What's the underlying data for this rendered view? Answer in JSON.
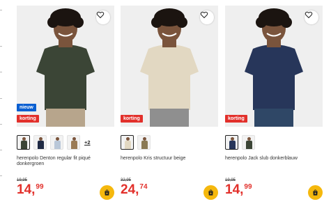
{
  "products": [
    {
      "title": "herenpolo Denton regular fit piqué donkergroen",
      "badges": {
        "new": "nieuw",
        "sale": "korting"
      },
      "old_price": "19,95",
      "price_int": "14,",
      "price_dec": "99",
      "more_colors": "+2",
      "shirt_color": "#3b4536",
      "pants_color": "#b7a58c",
      "swatch_colors": [
        "#3b4536",
        "#1f2a44",
        "#b9c7d8",
        "#9a7b55"
      ]
    },
    {
      "title": "herenpolo Kris structuur beige",
      "badges": {
        "sale": "korting"
      },
      "old_price": "32,95",
      "price_int": "24,",
      "price_dec": "74",
      "more_colors": "",
      "shirt_color": "#e2d8c2",
      "pants_color": "#8f8f8f",
      "swatch_colors": [
        "#e2d8c2",
        "#8a7a55"
      ]
    },
    {
      "title": "herenpolo Jack slub donkerblauw",
      "badges": {
        "sale": "korting"
      },
      "old_price": "19,95",
      "price_int": "14,",
      "price_dec": "99",
      "more_colors": "",
      "shirt_color": "#27365a",
      "pants_color": "#2f4766",
      "swatch_colors": [
        "#27365a",
        "#3b4536"
      ]
    }
  ],
  "icons": {
    "wishlist": "heart-icon",
    "cart": "shopping-bag-icon"
  },
  "colors": {
    "sale": "#e2302b",
    "new": "#0a5fd1",
    "cart_button": "#f5b80d"
  }
}
